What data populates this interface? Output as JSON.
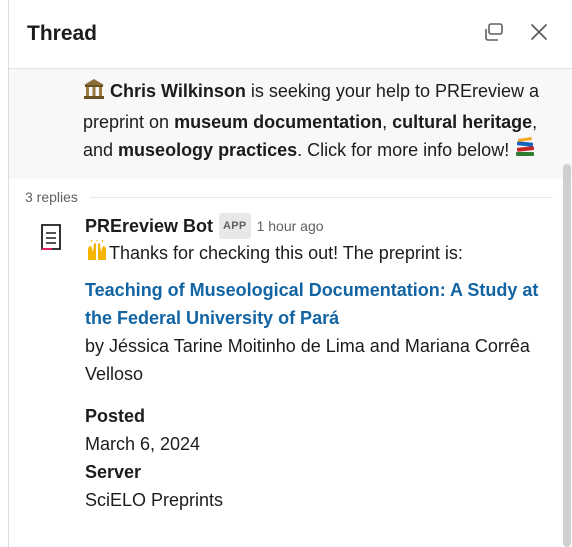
{
  "header": {
    "title": "Thread"
  },
  "parent": {
    "author": "Chris Wilkinson",
    "text_1": " is seeking your help to PREreview a preprint on ",
    "topic_1": "museum documentation",
    "sep_1": ", ",
    "topic_2": "cultural heritage",
    "sep_2": ", and ",
    "topic_3": "museology practices",
    "text_2": ". Click for more info below! "
  },
  "replies": {
    "count_label": "3 replies"
  },
  "reply": {
    "sender": "PREreview Bot",
    "badge": "APP",
    "time": "1 hour ago",
    "intro": "Thanks for checking this out! The preprint is:",
    "link_title": "Teaching of Museological Documentation: A Study at the Federal University of Pará",
    "authors": "by Jéssica Tarine Moitinho de Lima and Mariana Corrêa Velloso",
    "posted_label": "Posted",
    "posted_value": "March 6, 2024",
    "server_label": "Server",
    "server_value": "SciELO Preprints"
  },
  "icons": {
    "open_in_window": "open-window-icon",
    "close": "close-icon",
    "museum": "classical-building-icon",
    "books": "books-icon",
    "raised_hands": "raising-hands-icon",
    "bot_avatar": "document-icon"
  }
}
